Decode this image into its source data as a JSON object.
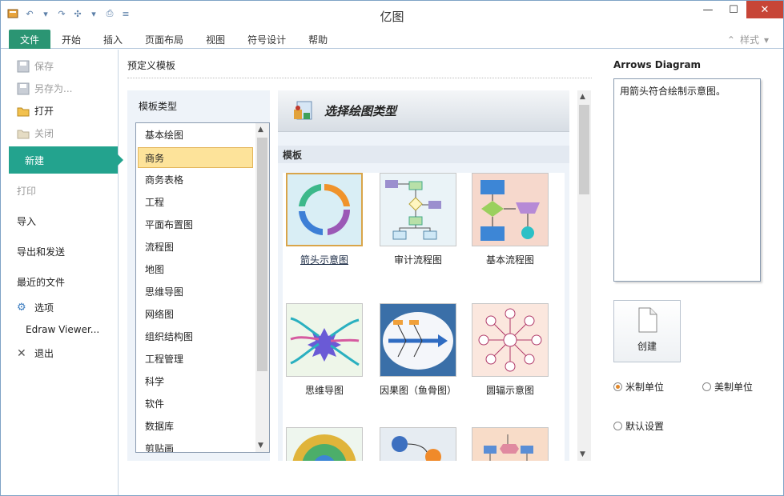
{
  "window": {
    "title": "亿图",
    "minimize": "—",
    "maximize": "☐",
    "close": "✕"
  },
  "ribbon": {
    "tabs": [
      "文件",
      "开始",
      "插入",
      "页面布局",
      "视图",
      "符号设计",
      "帮助"
    ],
    "style_label": "样式",
    "active_tab": "文件"
  },
  "nav": {
    "save": "保存",
    "save_as": "另存为...",
    "open": "打开",
    "close": "关闭",
    "new": "新建",
    "print": "打印",
    "import": "导入",
    "export": "导出和发送",
    "recent": "最近的文件",
    "options": "选项",
    "viewer": "Edraw Viewer...",
    "exit": "退出"
  },
  "main": {
    "preset_title": "预定义模板",
    "category_header": "模板类型",
    "categories": [
      "基本绘图",
      "商务",
      "商务表格",
      "工程",
      "平面布置图",
      "流程图",
      "地图",
      "思维导图",
      "网络图",
      "组织结构图",
      "工程管理",
      "科学",
      "软件",
      "数据库",
      "剪贴画"
    ],
    "selected_category": "商务",
    "banner_title": "选择绘图类型",
    "templates_label": "模板",
    "templates": [
      {
        "label": "箭头示意图",
        "icon": "arrows-thumbnail-icon",
        "selected": true
      },
      {
        "label": "审计流程图",
        "icon": "audit-flowchart-thumbnail-icon"
      },
      {
        "label": "基本流程图",
        "icon": "basic-flowchart-thumbnail-icon"
      },
      {
        "label": "思维导图",
        "icon": "mindmap-thumbnail-icon"
      },
      {
        "label": "因果图（鱼骨图）",
        "icon": "fishbone-thumbnail-icon"
      },
      {
        "label": "圆辐示意图",
        "icon": "spoke-diagram-thumbnail-icon"
      }
    ]
  },
  "right": {
    "preview_title": "Arrows Diagram",
    "description": "用箭头符合绘制示意图。",
    "create_label": "创建",
    "unit_metric": "米制单位",
    "unit_us": "美制单位",
    "default_settings": "默认设置",
    "metric_selected": true
  },
  "colors": {
    "accent": "#23a38e",
    "file_tab": "#2b9573",
    "selection": "#fde39a",
    "close_button": "#c74537"
  }
}
